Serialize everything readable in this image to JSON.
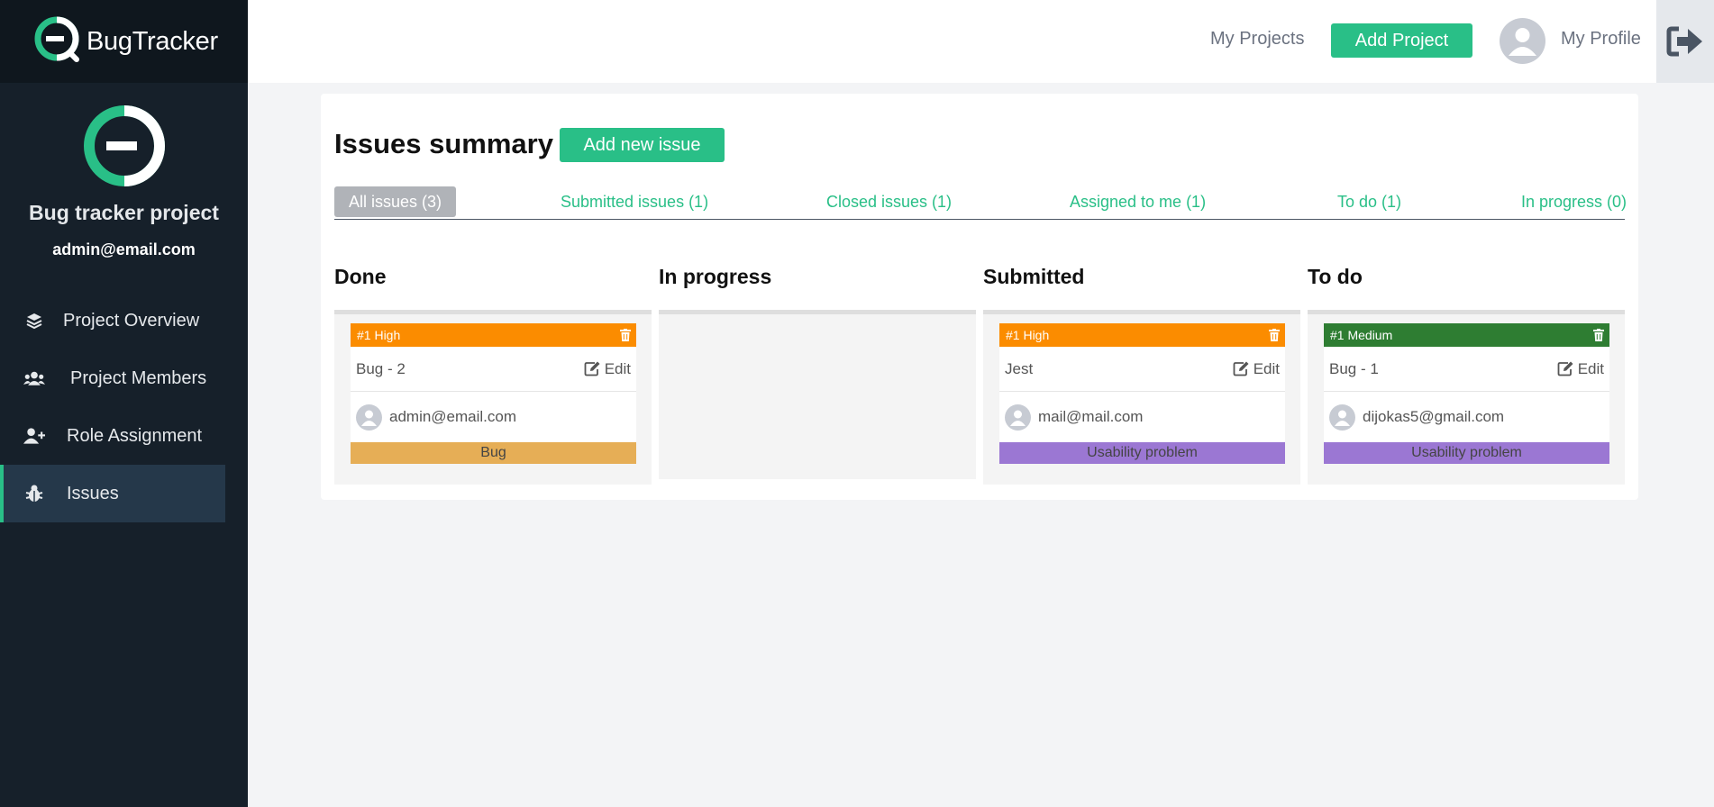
{
  "brand": {
    "title": "BugTracker"
  },
  "project": {
    "name": "Bug tracker project",
    "email": "admin@email.com"
  },
  "nav": [
    {
      "label": "Project Overview",
      "icon": "layers-icon"
    },
    {
      "label": "Project Members",
      "icon": "users-icon"
    },
    {
      "label": "Role Assignment",
      "icon": "user-plus-icon"
    },
    {
      "label": "Issues",
      "icon": "bug-icon",
      "active": true
    }
  ],
  "topbar": {
    "my_projects": "My Projects",
    "add_project": "Add Project",
    "my_profile": "My Profile",
    "logout_icon": "sign-out-icon"
  },
  "main": {
    "title": "Issues summary",
    "add_issue": "Add new issue",
    "tabs": [
      {
        "label": "All issues (3)",
        "active": true
      },
      {
        "label": "Submitted issues (1)"
      },
      {
        "label": "Closed issues (1)"
      },
      {
        "label": "Assigned to me (1)"
      },
      {
        "label": "To do (1)"
      },
      {
        "label": "In progress (0)"
      }
    ],
    "columns": [
      {
        "title": "Done",
        "card": {
          "priority": "#1 High",
          "priority_color": "#fb8c00",
          "name": "Bug - 2",
          "edit": "Edit",
          "assignee": "admin@email.com",
          "tag": "Bug",
          "tag_color": "#e6ae56"
        }
      },
      {
        "title": "In progress",
        "card": null
      },
      {
        "title": "Submitted",
        "card": {
          "priority": "#1 High",
          "priority_color": "#fb8c00",
          "name": "Jest",
          "edit": "Edit",
          "assignee": "mail@mail.com",
          "tag": "Usability problem",
          "tag_color": "#9b77d3"
        }
      },
      {
        "title": "To do",
        "card": {
          "priority": "#1 Medium",
          "priority_color": "#2e7d32",
          "name": "Bug - 1",
          "edit": "Edit",
          "assignee": "dijokas5@gmail.com",
          "tag": "Usability problem",
          "tag_color": "#9b77d3"
        }
      }
    ]
  }
}
